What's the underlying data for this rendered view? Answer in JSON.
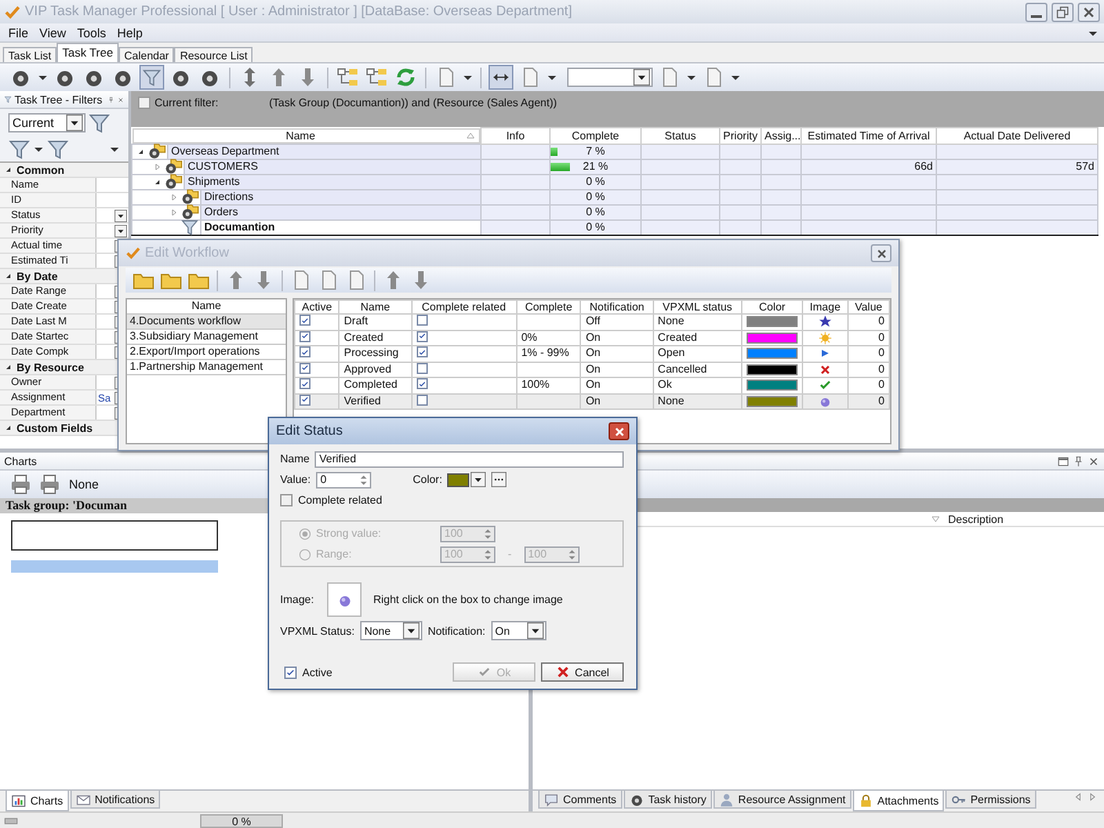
{
  "window": {
    "title": "VIP Task Manager Professional [ User : Administrator ] [DataBase: Overseas Department]"
  },
  "menu": [
    "File",
    "View",
    "Tools",
    "Help"
  ],
  "tabs": [
    {
      "label": "Task List",
      "selected": false
    },
    {
      "label": "Task Tree",
      "selected": true
    },
    {
      "label": "Calendar",
      "selected": false
    },
    {
      "label": "Resource List",
      "selected": false
    }
  ],
  "filter_panel": {
    "title": "Task Tree - Filters",
    "view": "Current",
    "groups": [
      {
        "label": "Common",
        "expanded": true,
        "fields": [
          {
            "label": "Name",
            "kind": "text"
          },
          {
            "label": "ID",
            "kind": "text"
          },
          {
            "label": "Status",
            "kind": "dropdown"
          },
          {
            "label": "Priority",
            "kind": "dropdown"
          },
          {
            "label": "Actual time",
            "kind": "dropdown"
          },
          {
            "label": "Estimated Ti",
            "kind": "dropdown"
          }
        ]
      },
      {
        "label": "By Date",
        "expanded": true,
        "fields": [
          {
            "label": "Date Range",
            "kind": "dropdown"
          },
          {
            "label": "Date Create",
            "kind": "dropdown"
          },
          {
            "label": "Date Last M",
            "kind": "dropdown"
          },
          {
            "label": "Date Startec",
            "kind": "dropdown"
          },
          {
            "label": "Date Compk",
            "kind": "dropdown"
          }
        ]
      },
      {
        "label": "By Resource",
        "expanded": true,
        "fields": [
          {
            "label": "Owner",
            "kind": "dropdown"
          },
          {
            "label": "Assignment",
            "kind": "dropdown",
            "value": "Sa"
          },
          {
            "label": "Department",
            "kind": "dropdown"
          }
        ]
      },
      {
        "label": "Custom Fields",
        "expanded": true
      }
    ]
  },
  "filter_bar": {
    "label": "Current filter:",
    "checked": false,
    "expression": "(Task Group  (Documantion)) and (Resource  (Sales Agent))"
  },
  "task_table": {
    "columns": [
      "Name",
      "Info",
      "Complete",
      "Status",
      "Priority",
      "Assig...",
      "Estimated Time of Arrival",
      "Actual Date Delivered"
    ],
    "rows": [
      {
        "name": "Overseas Department",
        "kind": "group",
        "expanded": true,
        "complete": "7 %",
        "level": 0.07,
        "selected": false,
        "children": [
          {
            "name": "CUSTOMERS",
            "kind": "group",
            "expanded": false,
            "complete": "21 %",
            "level": 0.21,
            "eta": "66d",
            "delivered": "57d",
            "selected": false
          },
          {
            "name": "Shipments",
            "kind": "group",
            "expanded": true,
            "complete": "0 %",
            "level": 0,
            "selected": false,
            "children": [
              {
                "name": "Directions",
                "kind": "group",
                "expanded": false,
                "complete": "0 %",
                "level": 0,
                "selected": false
              },
              {
                "name": "Orders",
                "kind": "group",
                "expanded": false,
                "complete": "0 %",
                "level": 0,
                "selected": false
              },
              {
                "name": "Documantion",
                "kind": "filter",
                "complete": "0 %",
                "level": 0,
                "selected": true
              }
            ]
          }
        ]
      }
    ]
  },
  "charts_panel": {
    "title": "Charts",
    "chart_type": "None",
    "task_group": "Task group: 'Documan",
    "tabs": [
      {
        "label": "Charts",
        "selected": true
      },
      {
        "label": "Notifications",
        "selected": false
      }
    ]
  },
  "details_panel": {
    "column": "Description",
    "tabs": [
      {
        "label": "Comments",
        "selected": false
      },
      {
        "label": "Task history",
        "selected": false
      },
      {
        "label": "Resource Assignment",
        "selected": false
      },
      {
        "label": "Attachments",
        "selected": true
      },
      {
        "label": "Permissions",
        "selected": false
      }
    ]
  },
  "status_bar": {
    "progress": "0 %",
    "level": 0
  },
  "workflow_dialog": {
    "title": "Edit Workflow",
    "list_column": "Name",
    "workflows": [
      {
        "name": "4.Documents workflow",
        "selected": true
      },
      {
        "name": "3.Subsidiary Management",
        "selected": false
      },
      {
        "name": "2.Export/Import operations",
        "selected": false
      },
      {
        "name": "1.Partnership Management",
        "selected": false
      }
    ],
    "columns": [
      "Active",
      "Name",
      "Complete related",
      "Complete",
      "Notification",
      "VPXML status",
      "Color",
      "Image",
      "Value"
    ],
    "statuses": [
      {
        "active": true,
        "name": "Draft",
        "complete_related": false,
        "notification": "Off",
        "vpxml_status": "None",
        "color": "#808080",
        "value": "0",
        "selected": false
      },
      {
        "active": true,
        "name": "Created",
        "complete_related": true,
        "complete": "0%",
        "notification": "On",
        "vpxml_status": "Created",
        "color": "#ff00ff",
        "value": "0",
        "selected": false
      },
      {
        "active": true,
        "name": "Processing",
        "complete_related": true,
        "complete": "1% - 99%",
        "notification": "On",
        "vpxml_status": "Open",
        "color": "#0080ff",
        "value": "0",
        "selected": false
      },
      {
        "active": true,
        "name": "Approved",
        "complete_related": false,
        "notification": "On",
        "vpxml_status": "Cancelled",
        "color": "#000000",
        "value": "0",
        "selected": false
      },
      {
        "active": true,
        "name": "Completed",
        "complete_related": true,
        "complete": "100%",
        "notification": "On",
        "vpxml_status": "Ok",
        "color": "#008080",
        "value": "0",
        "selected": false
      },
      {
        "active": true,
        "name": "Verified",
        "complete_related": false,
        "notification": "On",
        "vpxml_status": "None",
        "color": "#808000",
        "value": "0",
        "selected": true
      }
    ]
  },
  "status_dialog": {
    "title": "Edit Status",
    "name_label": "Name",
    "name": "Verified",
    "value_label": "Value:",
    "value": "0",
    "color_label": "Color:",
    "color": "#808000",
    "complete_related": {
      "label": "Complete related",
      "checked": false
    },
    "range_group": {
      "disabled": true,
      "strong_value": {
        "label": "Strong value:",
        "selected": true,
        "value": "100"
      },
      "range": {
        "label": "Range:",
        "selected": false,
        "from": "100",
        "separator": "-",
        "to": "100"
      }
    },
    "image_label": "Image:",
    "image_hint": "Right click on the box to  change image",
    "vpxml_label": "VPXML Status:",
    "vpxml": "None",
    "notification_label": "Notification:",
    "notification": "On",
    "active": {
      "label": "Active",
      "checked": true
    },
    "ok": {
      "label": "Ok",
      "disabled": true
    },
    "cancel": {
      "label": "Cancel",
      "disabled": false
    }
  }
}
